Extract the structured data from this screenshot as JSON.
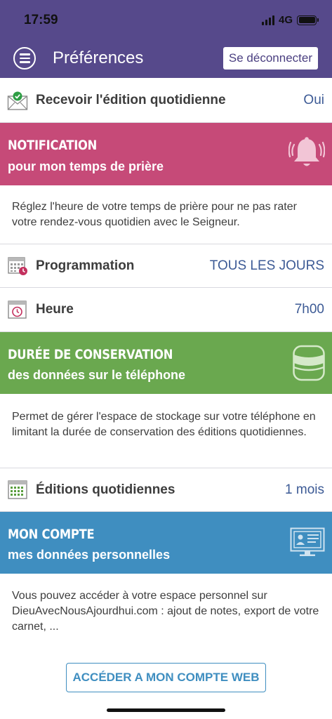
{
  "status_bar": {
    "time": "17:59",
    "network": "4G"
  },
  "nav": {
    "title": "Préférences",
    "logout_label": "Se déconnecter"
  },
  "daily_edition": {
    "label": "Recevoir l'édition quotidienne",
    "value": "Oui"
  },
  "notification": {
    "title": "NOTIFICATION",
    "subtitle": "pour mon temps de prière",
    "description": "Réglez l'heure de votre temps de prière pour ne pas rater votre rendez-vous quotidien avec le Seigneur.",
    "color": "#c64a78",
    "schedule": {
      "label": "Programmation",
      "value": "TOUS LES JOURS"
    },
    "time": {
      "label": "Heure",
      "value": "7h00"
    }
  },
  "storage": {
    "title": "DURÉE DE CONSERVATION",
    "subtitle": "des données sur le téléphone",
    "description": "Permet de gérer l'espace de stockage sur votre téléphone en limitant la durée de conservation des éditions quotidiennes.",
    "color": "#6aa84f",
    "editions": {
      "label": "Éditions quotidiennes",
      "value": "1 mois"
    }
  },
  "account": {
    "title": "MON COMPTE",
    "subtitle": "mes données personnelles",
    "description": "Vous pouvez accéder à votre espace personnel sur DieuAvecNousAjourdhui.com : ajout de notes, export de votre carnet, ...",
    "color": "#3f8ec0",
    "button_label": "ACCÉDER A MON COMPTE WEB"
  },
  "icons": {
    "menu": "menu-icon",
    "envelope": "envelope-check-icon",
    "bell": "bell-icon",
    "calendar": "calendar-clock-icon",
    "clock": "clock-icon",
    "database": "database-icon",
    "grid_calendar": "calendar-grid-icon",
    "account": "id-card-monitor-icon"
  },
  "colors": {
    "brand": "#56498b",
    "value_text": "#3c5a95"
  }
}
